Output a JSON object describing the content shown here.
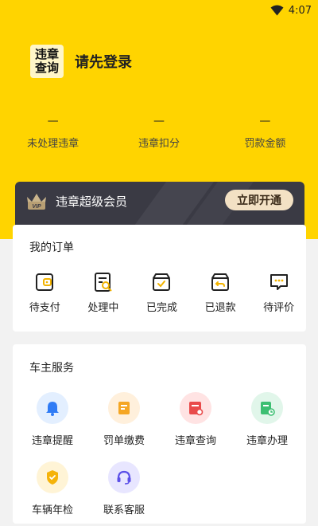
{
  "status_bar": {
    "time": "4:07"
  },
  "profile": {
    "logo_line1": "违章",
    "logo_line2": "查询",
    "login_text": "请先登录"
  },
  "stats": [
    {
      "value": "—",
      "label": "未处理违章"
    },
    {
      "value": "—",
      "label": "违章扣分"
    },
    {
      "value": "—",
      "label": "罚款金额"
    }
  ],
  "vip": {
    "badge": "VIP",
    "title": "违章超级会员",
    "button": "立即开通"
  },
  "orders": {
    "title": "我的订单",
    "items": [
      {
        "label": "待支付",
        "icon": "wallet-icon"
      },
      {
        "label": "处理中",
        "icon": "document-search-icon"
      },
      {
        "label": "已完成",
        "icon": "box-check-icon"
      },
      {
        "label": "已退款",
        "icon": "box-return-icon"
      },
      {
        "label": "待评价",
        "icon": "comment-icon"
      }
    ]
  },
  "services": {
    "title": "车主服务",
    "items": [
      {
        "label": "违章提醒",
        "icon": "bell-icon"
      },
      {
        "label": "罚单缴费",
        "icon": "ticket-pay-icon"
      },
      {
        "label": "违章查询",
        "icon": "violation-search-icon"
      },
      {
        "label": "违章办理",
        "icon": "process-icon"
      },
      {
        "label": "车辆年检",
        "icon": "annual-inspection-icon"
      },
      {
        "label": "联系客服",
        "icon": "customer-service-icon"
      }
    ]
  },
  "colors": {
    "brand_yellow": "#ffd400",
    "vip_dark": "#3a3a44",
    "vip_button": "#f3e1c4"
  }
}
